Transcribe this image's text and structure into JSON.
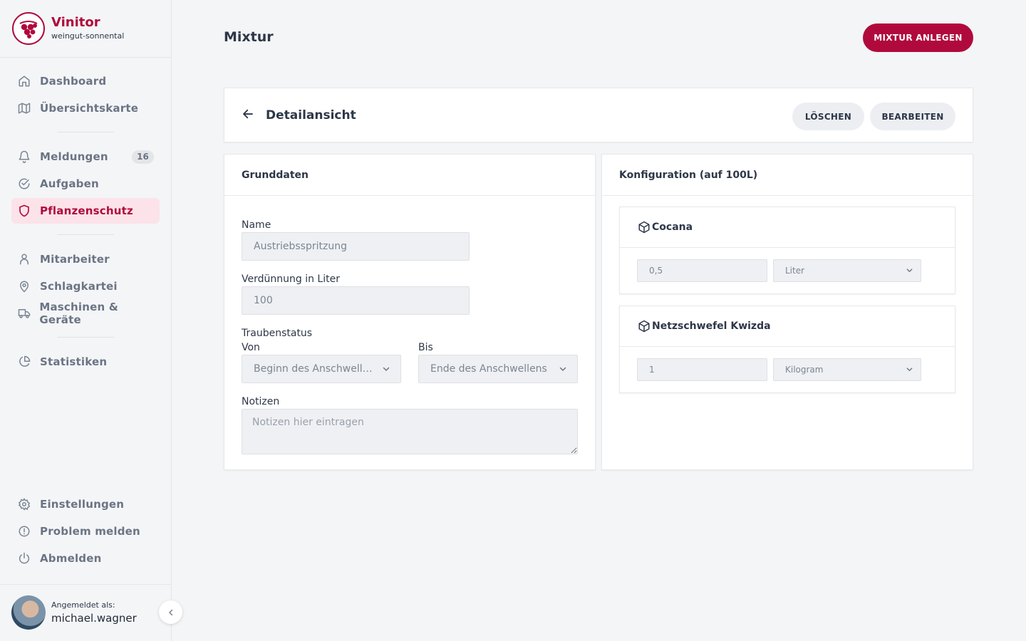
{
  "brand": {
    "name": "Vinitor",
    "tenant": "weingut-sonnental",
    "color": "#b00a3c"
  },
  "nav": {
    "top": [
      {
        "label": "Dashboard",
        "icon": "home-icon"
      },
      {
        "label": "Übersichtskarte",
        "icon": "map-icon"
      }
    ],
    "middle": [
      {
        "label": "Meldungen",
        "icon": "bell-icon",
        "badge": "16"
      },
      {
        "label": "Aufgaben",
        "icon": "check-circle-icon"
      },
      {
        "label": "Pflanzenschutz",
        "icon": "shield-icon",
        "active": true
      }
    ],
    "lower": [
      {
        "label": "Mitarbeiter",
        "icon": "user-icon"
      },
      {
        "label": "Schlagkartei",
        "icon": "map-pin-icon"
      },
      {
        "label": "Maschinen & Geräte",
        "icon": "truck-icon"
      }
    ],
    "stats": [
      {
        "label": "Statistiken",
        "icon": "pie-chart-icon"
      }
    ],
    "bottom": [
      {
        "label": "Einstellungen",
        "icon": "gear-icon"
      },
      {
        "label": "Problem melden",
        "icon": "alert-circle-icon"
      },
      {
        "label": "Abmelden",
        "icon": "power-icon"
      }
    ]
  },
  "user": {
    "prefix": "Angemeldet als:",
    "name": "michael.wagner"
  },
  "header": {
    "title": "Mixtur",
    "create_button": "MIXTUR ANLEGEN"
  },
  "detail": {
    "title": "Detailansicht",
    "delete_button": "LÖSCHEN",
    "edit_button": "BEARBEITEN"
  },
  "grunddaten": {
    "title": "Grunddaten",
    "name_label": "Name",
    "name_value": "Austriebsspritzung",
    "dilution_label": "Verdünnung in Liter",
    "dilution_value": "100",
    "grape_status_label": "Traubenstatus",
    "from_label": "Von",
    "from_value": "Beginn des Anschwellens",
    "to_label": "Bis",
    "to_value": "Ende des Anschwellens",
    "notes_label": "Notizen",
    "notes_placeholder": "Notizen hier eintragen"
  },
  "konfiguration": {
    "title": "Konfiguration (auf 100L)",
    "items": [
      {
        "name": "Cocana",
        "amount": "0,5",
        "unit": "Liter"
      },
      {
        "name": "Netzschwefel Kwizda",
        "amount": "1",
        "unit": "Kilogram"
      }
    ]
  }
}
